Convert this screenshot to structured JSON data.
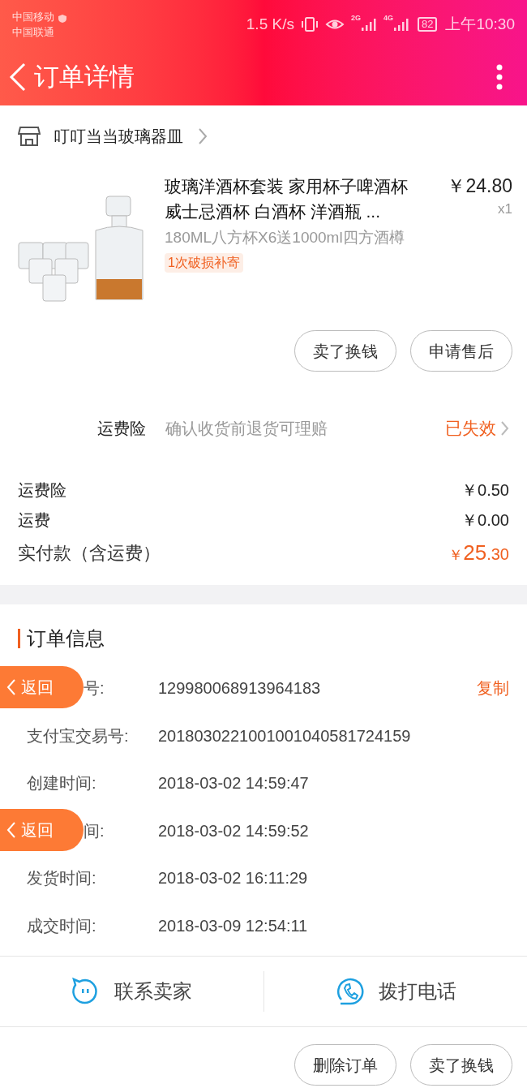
{
  "status_bar": {
    "carriers": [
      "中国移动",
      "中国联通"
    ],
    "speed": "1.5 K/s",
    "network_labels": [
      "2G",
      "4G"
    ],
    "battery": "82",
    "time": "上午10:30"
  },
  "header": {
    "title": "订单详情"
  },
  "shop": {
    "name": "叮叮当当玻璃器皿"
  },
  "product": {
    "title": "玻璃洋酒杯套装 家用杯子啤酒杯威士忌酒杯 白酒杯 洋酒瓶 ...",
    "spec": "180ML八方杯X6送1000ml四方酒樽",
    "tag": "1次破损补寄",
    "price": "￥24.80",
    "quantity": "x1"
  },
  "product_buttons": [
    "卖了换钱",
    "申请售后"
  ],
  "insurance": {
    "label": "运费险",
    "description": "确认收货前退货可理赔",
    "status": "已失效"
  },
  "costs": [
    {
      "label": "运费险",
      "value": "￥0.50"
    },
    {
      "label": "运费",
      "value": "￥0.00"
    }
  ],
  "total": {
    "label": "实付款（含运费）",
    "currency": "￥",
    "integer": "25",
    "decimal": ".30"
  },
  "order_info": {
    "title": "订单信息",
    "rows": [
      {
        "label": "号:",
        "value": "129980068913964183",
        "action": "复制",
        "back_button": "返回"
      },
      {
        "label": "支付宝交易号:",
        "value": "2018030221001001040581724159"
      },
      {
        "label": "创建时间:",
        "value": "2018-03-02 14:59:47"
      },
      {
        "label": "间:",
        "value": "2018-03-02 14:59:52",
        "back_button": "返回"
      },
      {
        "label": "发货时间:",
        "value": "2018-03-02 16:11:29"
      },
      {
        "label": "成交时间:",
        "value": "2018-03-09 12:54:11"
      }
    ]
  },
  "contact": [
    {
      "kind": "chat",
      "label": "联系卖家"
    },
    {
      "kind": "phone",
      "label": "拨打电话"
    }
  ],
  "bottom_buttons": [
    "删除订单",
    "卖了换钱"
  ]
}
